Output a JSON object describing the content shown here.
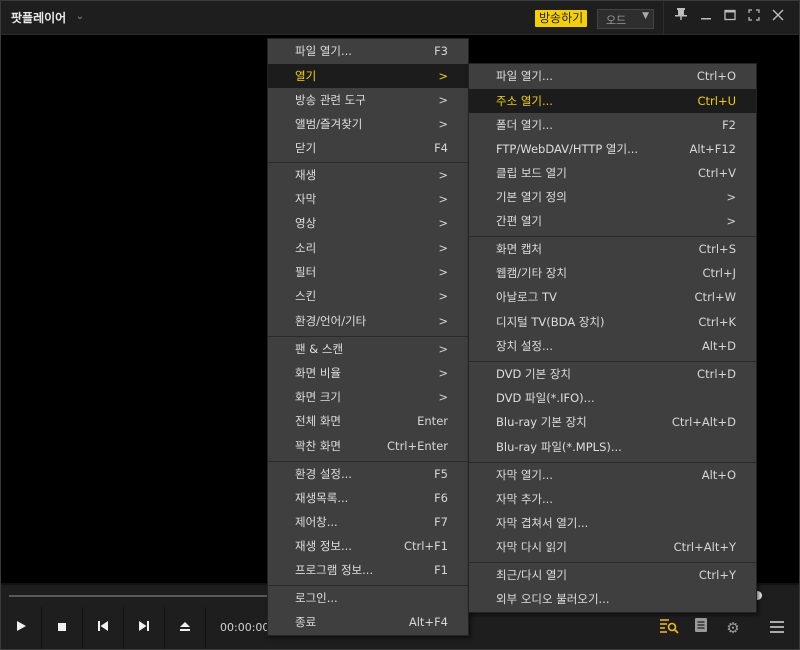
{
  "title_bar": {
    "app_title": "팟플레이어",
    "broadcast_button": "방송하기",
    "mode_select": "오드"
  },
  "controls": {
    "time": "00:00:00"
  },
  "main_menu": {
    "items": [
      {
        "label": "파일 열기...",
        "shortcut": "F3"
      },
      {
        "label": "열기",
        "shortcut": ">"
      },
      {
        "label": "방송 관련 도구",
        "shortcut": ">"
      },
      {
        "label": "앨범/즐겨찾기",
        "shortcut": ">"
      },
      {
        "label": "닫기",
        "shortcut": "F4"
      },
      {
        "label": "재생",
        "shortcut": ">"
      },
      {
        "label": "자막",
        "shortcut": ">"
      },
      {
        "label": "영상",
        "shortcut": ">"
      },
      {
        "label": "소리",
        "shortcut": ">"
      },
      {
        "label": "필터",
        "shortcut": ">"
      },
      {
        "label": "스킨",
        "shortcut": ">"
      },
      {
        "label": "환경/언어/기타",
        "shortcut": ">"
      },
      {
        "label": "팬 & 스캔",
        "shortcut": ">"
      },
      {
        "label": "화면 비율",
        "shortcut": ">"
      },
      {
        "label": "화면 크기",
        "shortcut": ">"
      },
      {
        "label": "전체 화면",
        "shortcut": "Enter"
      },
      {
        "label": "꽉찬 화면",
        "shortcut": "Ctrl+Enter"
      },
      {
        "label": "환경 설정...",
        "shortcut": "F5"
      },
      {
        "label": "재생목록...",
        "shortcut": "F6"
      },
      {
        "label": "제어창...",
        "shortcut": "F7"
      },
      {
        "label": "재생 정보...",
        "shortcut": "Ctrl+F1"
      },
      {
        "label": "프로그램 정보...",
        "shortcut": "F1"
      },
      {
        "label": "로그인...",
        "shortcut": ""
      },
      {
        "label": "종료",
        "shortcut": "Alt+F4"
      }
    ]
  },
  "open_submenu": {
    "items": [
      {
        "label": "파일 열기...",
        "shortcut": "Ctrl+O"
      },
      {
        "label": "주소 열기...",
        "shortcut": "Ctrl+U"
      },
      {
        "label": "폴더 열기...",
        "shortcut": "F2"
      },
      {
        "label": "FTP/WebDAV/HTTP 열기...",
        "shortcut": "Alt+F12"
      },
      {
        "label": "클립 보드 열기",
        "shortcut": "Ctrl+V"
      },
      {
        "label": "기본 열기 정의",
        "shortcut": ">"
      },
      {
        "label": "간편 열기",
        "shortcut": ">"
      },
      {
        "label": "화면 캡처",
        "shortcut": "Ctrl+S"
      },
      {
        "label": "웹캠/기타 장치",
        "shortcut": "Ctrl+J"
      },
      {
        "label": "아날로그 TV",
        "shortcut": "Ctrl+W"
      },
      {
        "label": "디지털 TV(BDA 장치)",
        "shortcut": "Ctrl+K"
      },
      {
        "label": "장치 설정...",
        "shortcut": "Alt+D"
      },
      {
        "label": "DVD 기본 장치",
        "shortcut": "Ctrl+D"
      },
      {
        "label": "DVD 파일(*.IFO)...",
        "shortcut": ""
      },
      {
        "label": "Blu-ray 기본 장치",
        "shortcut": "Ctrl+Alt+D"
      },
      {
        "label": "Blu-ray 파일(*.MPLS)...",
        "shortcut": ""
      },
      {
        "label": "자막 열기...",
        "shortcut": "Alt+O"
      },
      {
        "label": "자막 추가...",
        "shortcut": ""
      },
      {
        "label": "자막 겹쳐서 열기...",
        "shortcut": ""
      },
      {
        "label": "자막 다시 읽기",
        "shortcut": "Ctrl+Alt+Y"
      },
      {
        "label": "최근/다시 열기",
        "shortcut": "Ctrl+Y"
      },
      {
        "label": "외부 오디오 불러오기...",
        "shortcut": ""
      }
    ]
  }
}
